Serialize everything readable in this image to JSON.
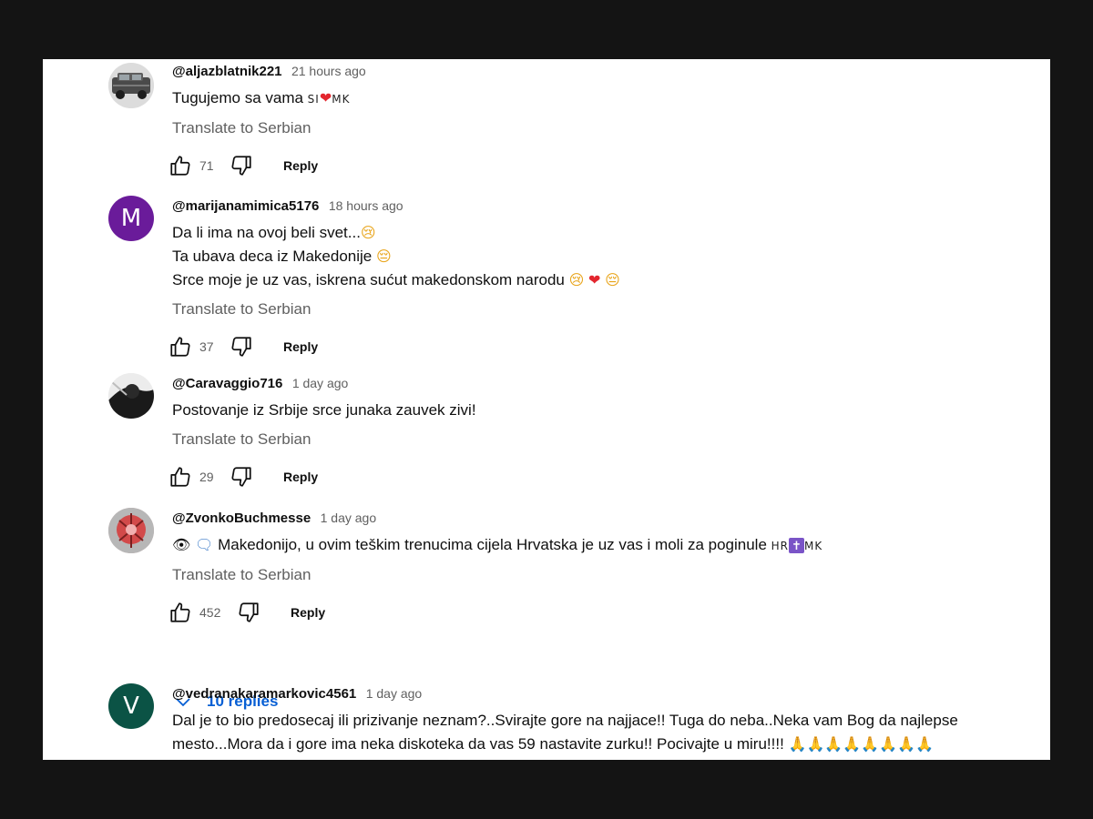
{
  "comments": [
    {
      "author": "@aljazblatnik221",
      "time": "21 hours ago",
      "lines": [
        "Tugujemo sa vama"
      ],
      "translate": "Translate to Serbian",
      "likes": "71",
      "reply": "Reply",
      "flags": [
        "SI",
        "MK"
      ]
    },
    {
      "author": "@marijanamimica5176",
      "time": "18 hours ago",
      "avatar_letter": "M",
      "avatar_color": "#6a1b9a",
      "lines": [
        "Da li ima na ovoj beli svet...",
        "Ta ubava deca iz Makedonije",
        "Srce moje je uz vas, iskrena sućut makedonskom narodu"
      ],
      "translate": "Translate to Serbian",
      "likes": "37",
      "reply": "Reply"
    },
    {
      "author": "@Caravaggio716",
      "time": "1 day ago",
      "lines": [
        "Postovanje iz Srbije srce junaka zauvek zivi!"
      ],
      "translate": "Translate to Serbian",
      "likes": "29",
      "reply": "Reply"
    },
    {
      "author": "@ZvonkoBuchmesse",
      "time": "1 day ago",
      "lines": [
        "Makedonijo, u ovim teškim trenucima cijela Hrvatska je uz vas i moli za poginule"
      ],
      "translate": "Translate to Serbian",
      "likes": "452",
      "reply": "Reply",
      "flags": [
        "HR",
        "MK"
      ],
      "replies_label": "10 replies"
    },
    {
      "author": "@vedranakaramarkovic4561",
      "time": "1 day ago",
      "avatar_letter": "V",
      "avatar_color": "#0b5345",
      "lines": [
        "Dal je to bio predosecaj ili prizivanje neznam?..Svirajte gore na najjace!! Tuga do neba..Neka vam Bog da najlepse",
        "mesto...Mora da i gore ima neka diskoteka da vas 59 nastavite zurku!! Pocivajte u miru!!!!"
      ]
    }
  ],
  "colors": {
    "link_blue": "#065fd4",
    "secondary_text": "#606060",
    "background": "#ffffff"
  },
  "icons": [
    "like-icon",
    "dislike-icon",
    "chevron-down-icon",
    "heart-emoji",
    "sad-face-emoji",
    "pensive-face-emoji",
    "eye-emoji",
    "speech-bubble-emoji",
    "latin-cross-emoji",
    "folded-hands-emoji"
  ]
}
